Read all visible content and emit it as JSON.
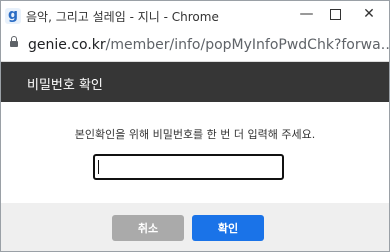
{
  "window": {
    "title": "음악, 그리고 설레임 - 지니 - Chrome",
    "app_icon_glyph": "g",
    "minimize_glyph": "—",
    "close_glyph": "✕"
  },
  "address_bar": {
    "domain": "genie.co.kr",
    "path": "/member/info/popMyInfoPwdChk?forwa…"
  },
  "popup": {
    "title": "비밀번호 확인",
    "instruction": "본인확인을 위해 비밀번호를 한 번 더 입력해 주세요.",
    "password_value": ""
  },
  "buttons": {
    "cancel_label": "취소",
    "confirm_label": "확인"
  },
  "colors": {
    "header_bg": "#363636",
    "confirm_bg": "#1a73e8",
    "cancel_bg": "#aaaaaa",
    "footer_bg": "#efefef"
  }
}
